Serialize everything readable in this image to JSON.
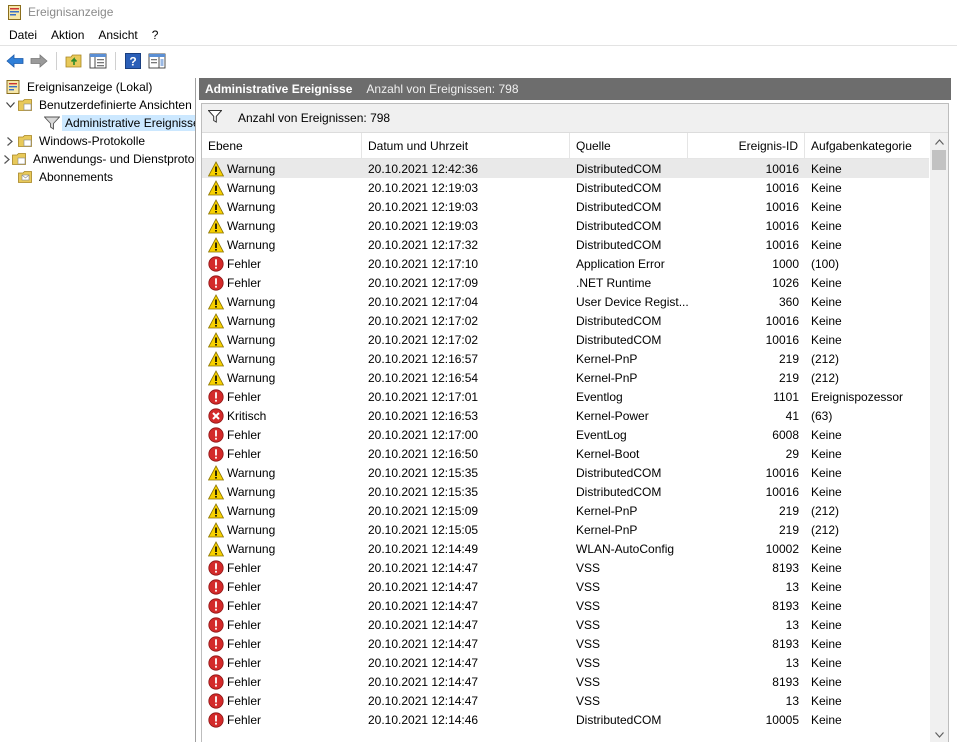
{
  "window": {
    "title": "Ereignisanzeige"
  },
  "menu": {
    "items": [
      "Datei",
      "Aktion",
      "Ansicht",
      "?"
    ]
  },
  "tree": {
    "items": [
      {
        "label": "Ereignisanzeige (Lokal)",
        "arrow": "",
        "icon": "event-viewer-icon",
        "indent": 0
      },
      {
        "label": "Benutzerdefinierte Ansichten",
        "arrow": "⌵",
        "icon": "folder-icon",
        "indent": 1
      },
      {
        "label": "Administrative Ereignisse",
        "arrow": "",
        "icon": "filter-icon",
        "indent": 2
      },
      {
        "label": "Windows-Protokolle",
        "arrow": "›",
        "icon": "folder-icon",
        "indent": 1
      },
      {
        "label": "Anwendungs- und Dienstprotokolle",
        "arrow": "›",
        "icon": "folder-icon",
        "indent": 1
      },
      {
        "label": "Abonnements",
        "arrow": "",
        "icon": "subscription-icon",
        "indent": 1
      }
    ],
    "selected": 2
  },
  "pane": {
    "title": "Administrative Ereignisse",
    "count_label": "Anzahl von Ereignissen: 798"
  },
  "filter": {
    "label": "Anzahl von Ereignissen: 798"
  },
  "table": {
    "headers": [
      "Ebene",
      "Datum und Uhrzeit",
      "Quelle",
      "Ereignis-ID",
      "Aufgabenkategorie"
    ],
    "rows": [
      {
        "level": "Warnung",
        "type": "warning",
        "date": "20.10.2021 12:42:36",
        "source": "DistributedCOM",
        "id": "10016",
        "category": "Keine"
      },
      {
        "level": "Warnung",
        "type": "warning",
        "date": "20.10.2021 12:19:03",
        "source": "DistributedCOM",
        "id": "10016",
        "category": "Keine"
      },
      {
        "level": "Warnung",
        "type": "warning",
        "date": "20.10.2021 12:19:03",
        "source": "DistributedCOM",
        "id": "10016",
        "category": "Keine"
      },
      {
        "level": "Warnung",
        "type": "warning",
        "date": "20.10.2021 12:19:03",
        "source": "DistributedCOM",
        "id": "10016",
        "category": "Keine"
      },
      {
        "level": "Warnung",
        "type": "warning",
        "date": "20.10.2021 12:17:32",
        "source": "DistributedCOM",
        "id": "10016",
        "category": "Keine"
      },
      {
        "level": "Fehler",
        "type": "error",
        "date": "20.10.2021 12:17:10",
        "source": "Application Error",
        "id": "1000",
        "category": "(100)"
      },
      {
        "level": "Fehler",
        "type": "error",
        "date": "20.10.2021 12:17:09",
        "source": ".NET Runtime",
        "id": "1026",
        "category": "Keine"
      },
      {
        "level": "Warnung",
        "type": "warning",
        "date": "20.10.2021 12:17:04",
        "source": "User Device Regist...",
        "id": "360",
        "category": "Keine"
      },
      {
        "level": "Warnung",
        "type": "warning",
        "date": "20.10.2021 12:17:02",
        "source": "DistributedCOM",
        "id": "10016",
        "category": "Keine"
      },
      {
        "level": "Warnung",
        "type": "warning",
        "date": "20.10.2021 12:17:02",
        "source": "DistributedCOM",
        "id": "10016",
        "category": "Keine"
      },
      {
        "level": "Warnung",
        "type": "warning",
        "date": "20.10.2021 12:16:57",
        "source": "Kernel-PnP",
        "id": "219",
        "category": "(212)"
      },
      {
        "level": "Warnung",
        "type": "warning",
        "date": "20.10.2021 12:16:54",
        "source": "Kernel-PnP",
        "id": "219",
        "category": "(212)"
      },
      {
        "level": "Fehler",
        "type": "error",
        "date": "20.10.2021 12:17:01",
        "source": "Eventlog",
        "id": "1101",
        "category": "Ereignispozessor"
      },
      {
        "level": "Kritisch",
        "type": "critical",
        "date": "20.10.2021 12:16:53",
        "source": "Kernel-Power",
        "id": "41",
        "category": "(63)"
      },
      {
        "level": "Fehler",
        "type": "error",
        "date": "20.10.2021 12:17:00",
        "source": "EventLog",
        "id": "6008",
        "category": "Keine"
      },
      {
        "level": "Fehler",
        "type": "error",
        "date": "20.10.2021 12:16:50",
        "source": "Kernel-Boot",
        "id": "29",
        "category": "Keine"
      },
      {
        "level": "Warnung",
        "type": "warning",
        "date": "20.10.2021 12:15:35",
        "source": "DistributedCOM",
        "id": "10016",
        "category": "Keine"
      },
      {
        "level": "Warnung",
        "type": "warning",
        "date": "20.10.2021 12:15:35",
        "source": "DistributedCOM",
        "id": "10016",
        "category": "Keine"
      },
      {
        "level": "Warnung",
        "type": "warning",
        "date": "20.10.2021 12:15:09",
        "source": "Kernel-PnP",
        "id": "219",
        "category": "(212)"
      },
      {
        "level": "Warnung",
        "type": "warning",
        "date": "20.10.2021 12:15:05",
        "source": "Kernel-PnP",
        "id": "219",
        "category": "(212)"
      },
      {
        "level": "Warnung",
        "type": "warning",
        "date": "20.10.2021 12:14:49",
        "source": "WLAN-AutoConfig",
        "id": "10002",
        "category": "Keine"
      },
      {
        "level": "Fehler",
        "type": "error",
        "date": "20.10.2021 12:14:47",
        "source": "VSS",
        "id": "8193",
        "category": "Keine"
      },
      {
        "level": "Fehler",
        "type": "error",
        "date": "20.10.2021 12:14:47",
        "source": "VSS",
        "id": "13",
        "category": "Keine"
      },
      {
        "level": "Fehler",
        "type": "error",
        "date": "20.10.2021 12:14:47",
        "source": "VSS",
        "id": "8193",
        "category": "Keine"
      },
      {
        "level": "Fehler",
        "type": "error",
        "date": "20.10.2021 12:14:47",
        "source": "VSS",
        "id": "13",
        "category": "Keine"
      },
      {
        "level": "Fehler",
        "type": "error",
        "date": "20.10.2021 12:14:47",
        "source": "VSS",
        "id": "8193",
        "category": "Keine"
      },
      {
        "level": "Fehler",
        "type": "error",
        "date": "20.10.2021 12:14:47",
        "source": "VSS",
        "id": "13",
        "category": "Keine"
      },
      {
        "level": "Fehler",
        "type": "error",
        "date": "20.10.2021 12:14:47",
        "source": "VSS",
        "id": "8193",
        "category": "Keine"
      },
      {
        "level": "Fehler",
        "type": "error",
        "date": "20.10.2021 12:14:47",
        "source": "VSS",
        "id": "13",
        "category": "Keine"
      },
      {
        "level": "Fehler",
        "type": "error",
        "date": "20.10.2021 12:14:46",
        "source": "DistributedCOM",
        "id": "10005",
        "category": "Keine"
      }
    ]
  },
  "colors": {
    "warning": "#f7d000",
    "error": "#d32a2a",
    "critical": "#d32a2a",
    "header_bar": "#6d6d6d",
    "selection": "#cce8ff"
  }
}
